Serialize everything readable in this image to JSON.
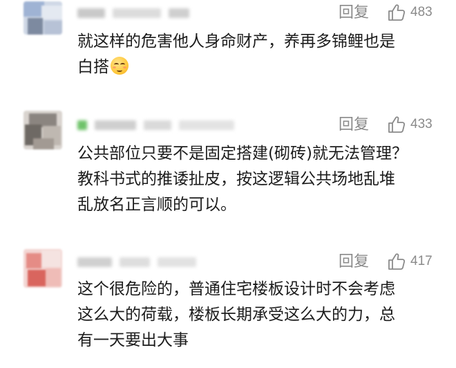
{
  "comments": [
    {
      "reply_label": "回复",
      "like_count": "483",
      "lines": [
        "就这样的危害他人身命财产，养再多锦鲤也是",
        "白搭"
      ],
      "emoji_icon": "relieved-face-emoji"
    },
    {
      "reply_label": "回复",
      "like_count": "433",
      "lines": [
        "公共部位只要不是固定搭建(砌砖)就无法管理？",
        "教科书式的推诿扯皮，按这逻辑公共场地乱堆",
        "乱放名正言顺的可以。"
      ]
    },
    {
      "reply_label": "回复",
      "like_count": "417",
      "lines": [
        "这个很危险的，普通住宅楼板设计时不会考虑",
        "这么大的荷载，楼板长期承受这么大的力，总",
        "有一天要出大事"
      ]
    }
  ],
  "colors": {
    "meta_text": "#8a8a8a",
    "body_text": "#1c1c1c",
    "background": "#ffffff"
  }
}
